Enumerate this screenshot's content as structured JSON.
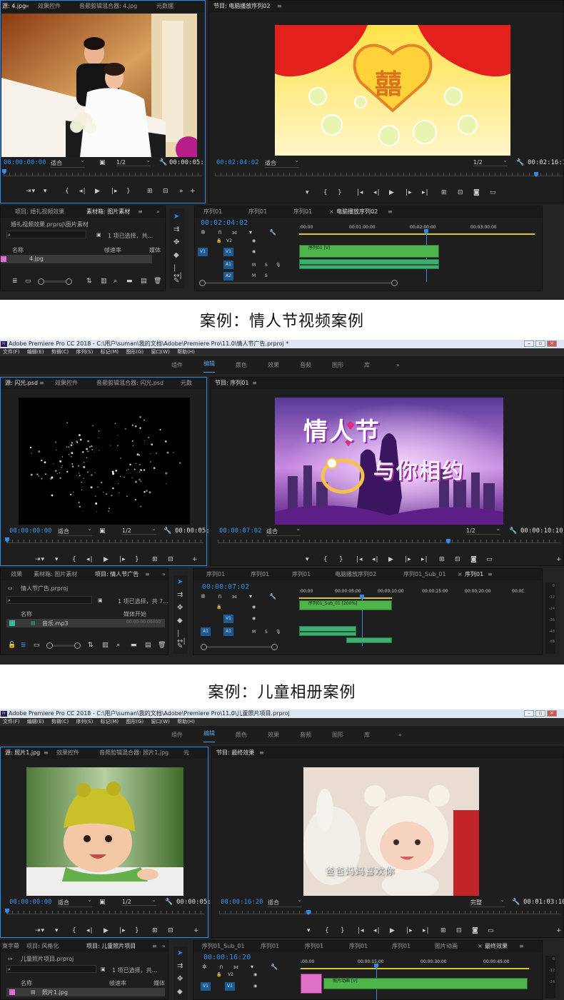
{
  "case1": {
    "source_tabs": [
      "源: 4.jpg",
      "效果控件",
      "音频剪辑混合器: 4.jpg",
      "元数据"
    ],
    "program_tab": "节目: 电脑播放序列02",
    "src_tc": "00:00:00:00",
    "src_fit": "适合",
    "src_res": "1/2",
    "src_dur": "00:00:05:",
    "prog_tc": "00:02:04:02",
    "prog_fit": "适合",
    "prog_res": "1/2",
    "prog_dur": "00:02:16:17",
    "project_tabs": [
      "项目: 婚礼视频效果",
      "素材箱: 图片素材"
    ],
    "project_path": "婚礼视频效果.prproj\\图片素材",
    "project_status": "1 项已选择，共...",
    "col_name": "名称",
    "col_rate": "帧速率",
    "col_media": "媒体",
    "item": "4.jpg",
    "seq_tabs": [
      "序列01",
      "序列01",
      "序列01",
      "电脑播放序列02"
    ],
    "seq_tc": "00:02:04:02",
    "ruler_marks": [
      ":00:00",
      "00:01:00:00",
      "00:02:00:00",
      "00:03:00:00"
    ],
    "clip_v1": "序列01 [V]",
    "tracks": [
      "V2",
      "V1",
      "A1",
      "A2"
    ],
    "heart_char": "囍"
  },
  "caption1": "案例：情人节视频案例",
  "case2": {
    "app_title": "Adobe Premiere Pro CC 2018 - C:\\用户\\suman\\我的文档\\Adobe\\Premiere Pro\\11.0\\情人节广告.prproj *",
    "menus": [
      "文件(F)",
      "编辑(E)",
      "剪辑(C)",
      "序列(S)",
      "标记(M)",
      "图形(G)",
      "窗口(W)",
      "帮助(H)"
    ],
    "workspaces": [
      "组件",
      "编辑",
      "颜色",
      "效果",
      "音频",
      "图形",
      "库"
    ],
    "ws_more": "»",
    "source_tabs": [
      "源: 闪光.psd",
      "效果控件",
      "音频剪辑混合器: 闪光.psd",
      "元数"
    ],
    "program_tab": "节目: 序列01",
    "src_tc": "00:00:00:00",
    "src_fit": "适合",
    "src_res": "1/2",
    "src_dur": "00:00:05:",
    "prog_tc": "00:00:07:02",
    "prog_fit": "适合",
    "prog_res": "1/2",
    "prog_dur": "00:00:10:10",
    "title_a": "情人节",
    "title_b": "与你相约",
    "project_tabs": [
      "效果",
      "素材箱: 图片素材",
      "项目: 情人节广告"
    ],
    "project_path": "情人节广告.prproj",
    "project_status": "1 项已选择，共 7...",
    "col_name": "名称",
    "col_media": "媒体开始",
    "item": "音乐.mp3",
    "item_tc": "00:00:00:00000",
    "seq_tabs": [
      "序列01",
      "序列01",
      "序列01",
      "电脑播放序列02",
      "序列01_Sub_01",
      "序列01"
    ],
    "seq_tc": "00:00:07:02",
    "ruler_marks": [
      ":00:00",
      "00:00:05:00",
      "00:00:10:00",
      "00:00:15:00",
      "00:00:20:00",
      "00:0C"
    ],
    "clip_v1": "序列01_Sub_01 [200%]",
    "tracks": [
      "V1",
      "A1"
    ],
    "meter": [
      "0",
      "-12",
      "-24",
      "-36",
      "-48",
      "dB"
    ]
  },
  "caption2": "案例：儿童相册案例",
  "case3": {
    "app_title": "Adobe Premiere Pro CC 2018 - C:\\用户\\suman\\我的文档\\Adobe\\Premiere Pro\\11.0\\儿童照片项目.prproj",
    "menus": [
      "文件(F)",
      "编辑(E)",
      "剪辑(C)",
      "序列(S)",
      "标记(M)",
      "图形(G)",
      "窗口(W)",
      "帮助(H)"
    ],
    "workspaces": [
      "组件",
      "编辑",
      "颜色",
      "效果",
      "音频",
      "图形",
      "库"
    ],
    "ws_more": "»",
    "source_tabs": [
      "源: 照片1.jpg",
      "效果控件",
      "音频剪辑混合器: 照片1.jpg",
      "元"
    ],
    "program_tab": "节目: 最终效果",
    "src_tc": "00:00:00:00",
    "src_fit": "适合",
    "src_res": "1/2",
    "src_dur": "00:00:05:",
    "prog_tc": "00:00:16:20",
    "prog_fit": "适合",
    "prog_res": "完整",
    "prog_dur": "00:01:03:10",
    "subtitle": "爸爸妈妈喜欢你",
    "project_tabs": [
      "束字幕",
      "项目: 风格化",
      "项目: 儿童照片项目"
    ],
    "project_path": "儿童照片项目.prproj",
    "project_status": "1 项已选择，共...",
    "col_name": "名称",
    "col_rate": "帧速率",
    "col_media": "媒体",
    "item": "照片1.jpg",
    "seq_tabs": [
      "序列01_Sub_01",
      "序列01",
      "序列01",
      "序列01",
      "序列01",
      "图片动画",
      "最终效果"
    ],
    "seq_tc": "00:00:16:20",
    "ruler_marks": [
      ":00:00",
      "00:00:15:00",
      "00:00:30:00",
      "00:00:45:00"
    ],
    "clip_v1": "照片动画 [V]",
    "tracks": [
      "V2",
      "V1"
    ],
    "meter": [
      "0",
      "-12",
      "-24"
    ]
  }
}
